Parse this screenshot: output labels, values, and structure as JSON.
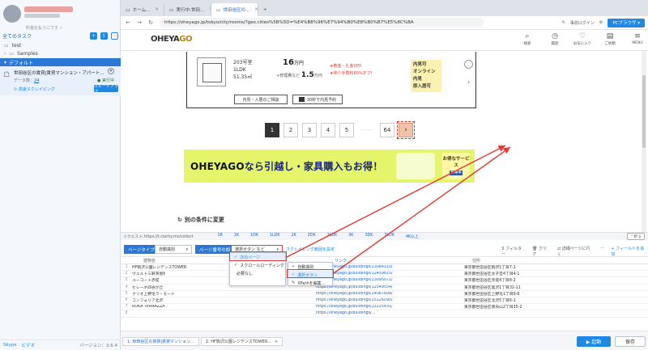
{
  "sidebar": {
    "slogan": "料金を払うにです ✓",
    "all_tasks": "全てのタスク",
    "tool_icons": [
      "+",
      "⇪",
      "⋯"
    ],
    "folders": [
      {
        "name": "test"
      },
      {
        "name": "Samples"
      }
    ],
    "default_group": "デフォルト",
    "task": {
      "title": "世田谷区の賃貸|賃貸マンション・アパート...",
      "meta_label": "データ数：",
      "meta_value": "24",
      "status": "● 実行中",
      "link": "↻ 高速スクレイピング",
      "speed_btn": "スピードアップ"
    },
    "bottom": {
      "skype": "Skype",
      "video": "ビデオ",
      "version": "バージョン：3.6.4"
    }
  },
  "browser": {
    "tabs": [
      {
        "label": "ホーム...",
        "icon": "▭"
      },
      {
        "label": "実行中:世田...",
        "icon": "▭"
      },
      {
        "label": "世田谷区の...",
        "icon": "▭",
        "active": true
      }
    ],
    "url": "https://oheyago.jp/tokyo/city/rooms/?geo.cities%5B%5D=%E4%B8%96%E7%94%B0%E8%B0%B7%E5%8C%BA",
    "login": "事前ログイン",
    "pc_btn": "PCブラウザ ▾"
  },
  "site": {
    "logo_main": "OHEYA",
    "logo_go": "GO",
    "nav": [
      {
        "label": "検索",
        "icon": "⌕"
      },
      {
        "label": "履歴",
        "icon": "◷"
      },
      {
        "label": "お気に入り",
        "icon": "♡"
      },
      {
        "label": "ご依頼",
        "icon": "▤"
      },
      {
        "label": "MENU",
        "icon": "≡"
      }
    ],
    "listing": {
      "rooms": [
        "203号室",
        "1LDK",
        "51.35㎡"
      ],
      "rent": "16",
      "rent_unit": "万円",
      "sub_label": "+管理費など",
      "sub_value": "1.5",
      "sub_unit": "万円",
      "campaign": [
        "★敷金・礼金0円!",
        "★仲介手数料80%オフ!"
      ],
      "tags": [
        "内見可",
        "オンライン内見",
        "即入居可"
      ],
      "btn_consult": "内見・入居のご相談",
      "btn_reserve": "30秒で内見予約"
    },
    "pager": [
      "1",
      "2",
      "3",
      "4",
      "5",
      "·····",
      "64",
      "›"
    ],
    "banner": {
      "brand": "OHEYAGO",
      "text": "なら引越し・家具購入もお得！",
      "box_top": "お得なサービス",
      "box_btn": "を知る ●"
    },
    "other_conditions": "別の条件に変更"
  },
  "reqbar": {
    "label": "リクエスト:https://t.clarity.ms/collect",
    "rooms": [
      "1R",
      "1K",
      "1DK",
      "1LDK",
      "2K",
      "2DK",
      "2LDK",
      "3K",
      "3DK",
      "3LDK",
      "4K以上"
    ],
    "fold": "⌃折る"
  },
  "toolbar": {
    "page_type": "ページタイプ",
    "page_type_val": "自動識別",
    "page_setting": "ページ番号の設定",
    "select_btn": "選択ボタン など",
    "scrape_range": "スクレイピング範囲を設定",
    "filter": "フィルター",
    "clear": "クリア",
    "detail": "詳細ページに行く",
    "add_field": "+ フィールドを追加"
  },
  "menu1": [
    "次のページ",
    "スクロールローディング",
    "必要なし"
  ],
  "menu2": [
    "自動識別",
    "選択ボタン",
    "XPathを編集..."
  ],
  "table": {
    "headers": [
      "建物名",
      "リンク",
      "住所"
    ],
    "rows": [
      [
        "HF駒沢公園レジデンスTOWER",
        "https://oheyago.jp/buildings/13084110/",
        "東京都世田谷区駒沢1丁目7-1"
      ],
      [
        "ヴェルト三軒茶屋Ⅱ",
        "https://oheyago.jp/buildings/12459815/",
        "東京都世田谷区太子堂4丁目4-1"
      ],
      [
        "ユーコート赤堤",
        "https://oheyago.jp/buildings/13095071/",
        "東京都世田谷区赤堤4丁目8-2"
      ],
      [
        "セレーネ四谷が丘",
        "https://oheyago.jp/buildings/12549554/",
        "東京都世田谷区奥沢1丁目32-11"
      ],
      [
        "クリオ上野毛ラ・モード",
        "https://oheyago.jp/buildings/14067608/",
        "東京都世田谷区上野毛1丁目9-6"
      ],
      [
        "コンフォリア北沢",
        "https://oheyago.jp/buildings/15126090/",
        "東京都世田谷区北沢5丁目6-1"
      ],
      [
        "ROKA TERRAZZA",
        "https://oheyago.jp/buildings/12225431/",
        "東京都世田谷区南烏山2丁目35-2"
      ],
      [
        "",
        "https://oheyago.jp/buildings/...",
        ""
      ]
    ]
  },
  "footer": {
    "tabs": [
      "1. 世田谷区の賃貸|賃貸マンション...",
      "2. HF駒沢公園レジデンスTOWER..."
    ],
    "run": "▶ 起動",
    "save": "保存"
  }
}
